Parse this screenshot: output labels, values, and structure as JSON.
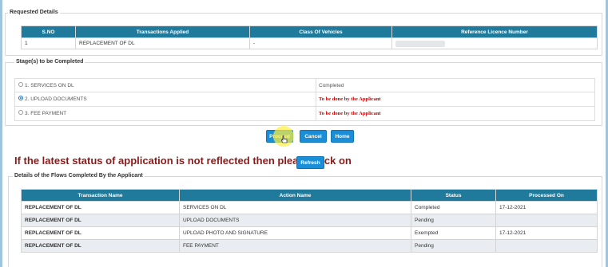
{
  "requested_details": {
    "legend": "Requested Details",
    "headers": [
      "S.NO",
      "Transactions Applied",
      "Class Of Vehicles",
      "Reference Licence Number"
    ],
    "rows": [
      [
        "1",
        "REPLACEMENT OF DL",
        "-",
        ""
      ]
    ]
  },
  "stages": {
    "legend": "Stage(s) to be Completed",
    "items": [
      {
        "label": "1.  SERVICES ON DL",
        "status": "Completed",
        "checked": false
      },
      {
        "label": "2.  UPLOAD DOCUMENTS",
        "status": "To be done by the Applicant",
        "checked": true
      },
      {
        "label": "3.  FEE PAYMENT",
        "status": "To be done by the Applicant",
        "checked": false
      }
    ]
  },
  "buttons": {
    "proceed": "Proceed",
    "cancel": "Cancel",
    "home": "Home",
    "refresh": "Refresh"
  },
  "notice": "If the latest status of application is not reflected then please click on",
  "flows": {
    "legend": "Details of the Flows Completed By the Applicant",
    "headers": [
      "Transaction Name",
      "Action Name",
      "Status",
      "Processed On"
    ],
    "rows": [
      [
        "REPLACEMENT OF DL",
        "SERVICES ON DL",
        "Completed",
        "17-12-2021"
      ],
      [
        "REPLACEMENT OF DL",
        "UPLOAD DOCUMENTS",
        "Pending",
        ""
      ],
      [
        "REPLACEMENT OF DL",
        "UPLOAD PHOTO AND SIGNATURE",
        "Exempted",
        "17-12-2021"
      ],
      [
        "REPLACEMENT OF DL",
        "FEE PAYMENT",
        "Pending",
        ""
      ]
    ]
  },
  "colors": {
    "header_bg": "#1f7a9c",
    "button_bg": "#1a8fd8",
    "notice": "#8b1a1a",
    "pending_red": "#cc0000"
  }
}
